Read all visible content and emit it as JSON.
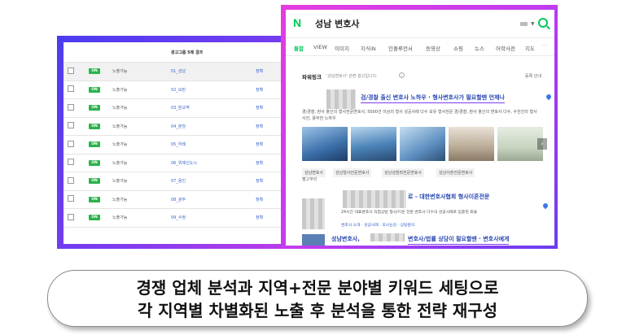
{
  "table": {
    "header_group": "광고그룹 5례 결과",
    "rows": [
      {
        "status": "ON",
        "label": "노출가능",
        "group": "01_성남",
        "action": "정확",
        "selected": true
      },
      {
        "status": "ON",
        "label": "노출가능",
        "group": "02_모란",
        "action": "정확"
      },
      {
        "status": "ON",
        "label": "노출가능",
        "group": "03_판교역",
        "action": "정확"
      },
      {
        "status": "ON",
        "label": "노출가능",
        "group": "04_분당",
        "action": "정확"
      },
      {
        "status": "ON",
        "label": "노출가능",
        "group": "05_하례",
        "action": "정확"
      },
      {
        "status": "ON",
        "label": "노출가능",
        "group": "06_위례신도시",
        "action": "정확"
      },
      {
        "status": "ON",
        "label": "노출가능",
        "group": "07_용인",
        "action": "정확"
      },
      {
        "status": "ON",
        "label": "노출가능",
        "group": "08_광주",
        "action": "정확"
      },
      {
        "status": "ON",
        "label": "노출가능",
        "group": "09_수정",
        "action": "정확"
      }
    ]
  },
  "search": {
    "logo": "N",
    "query": "성남 변호사",
    "tabs": [
      "통합",
      "VIEW",
      "이미지",
      "지식iN",
      "인플루언서",
      "동영상",
      "쇼핑",
      "뉴스",
      "어학사전",
      "지도"
    ],
    "tabs_more": "···",
    "powerlink": {
      "title": "파워링크",
      "subtitle": "'성남변호사' 관련 광고입니다.",
      "register": "등록 안내"
    },
    "ad1": {
      "title": "검/경찰 출신 변호사 노하우 · 형사변호사가 필요할땐 언제나",
      "desc": "경/경찰, 판사 출신의 형사전문변호사, 5000건 이상의 형사 성공사례 다수 보유 형사전문 경/경찰, 판사 출신의 변호사 다수, 수천건의 형사사건, 풍부한 노하우"
    },
    "keywords": [
      "성남변호사",
      "성남형사전문변호사",
      "성남성범죄전문변호사",
      "성남이혼전문변호사"
    ],
    "keywords_more": "펼고무리",
    "ad2": {
      "title": "로 - 대한변호사협회 형사이혼전문",
      "desc": "24시간 대표변호사 직접상담 형사/이혼 전문 변호사 다수의 성공사례로 입증된 효율",
      "links": "변호사 소개 · 성공사례 · 오시는길 · 상담문의"
    },
    "ad3": {
      "title_prefix": "성남변호사,",
      "title_suffix": "변호사/법률 상담이 필요할땐 · 변호사에게"
    }
  },
  "caption": {
    "line1": "경쟁 업체 분석과 지역+전문 분야별 키워드 세팅으로",
    "line2": "각 지역별 차별화된 노출 후 분석을 통한 전략 재구성"
  }
}
